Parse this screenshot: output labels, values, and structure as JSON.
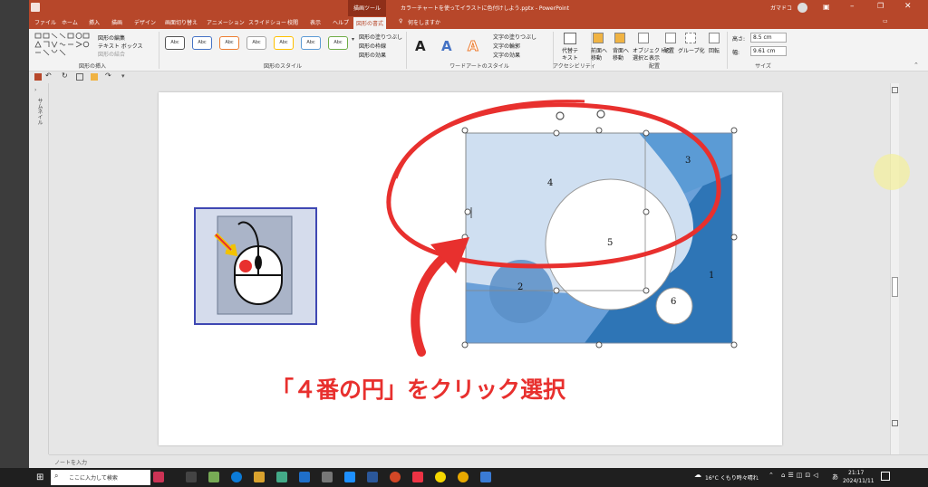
{
  "titlebar": {
    "context_label": "描画ツール",
    "doc_title": "カラーチャートを使ってイラストに色付けしよう.pptx - PowerPoint",
    "user": "ガマドコ"
  },
  "tabs": [
    "ファイル",
    "ホーム",
    "挿入",
    "描画",
    "デザイン",
    "画面切り替え",
    "アニメーション",
    "スライドショー",
    "校閲",
    "表示",
    "ヘルプ",
    "図形の書式"
  ],
  "tell_me": "何をしますか",
  "ribbon": {
    "insert_shapes": {
      "label": "図形の挿入",
      "edit_shape": "図形の編集",
      "text_box": "テキスト ボックス",
      "merge": "図形の結合"
    },
    "shape_styles": {
      "label": "図形のスタイル",
      "sample": "Abc",
      "fill": "図形の塗りつぶし",
      "outline": "図形の枠線",
      "effects": "図形の効果"
    },
    "wordart": {
      "label": "ワードアートのスタイル",
      "letter": "A",
      "text_fill": "文字の塗りつぶし",
      "text_outline": "文字の輪郭",
      "text_effects": "文字の効果"
    },
    "accessibility": {
      "label": "アクセシビリティ",
      "alt_text_1": "代替テ",
      "alt_text_2": "キスト"
    },
    "arrange": {
      "label": "配置",
      "forward_1": "前面へ",
      "forward_2": "移動",
      "backward_1": "背面へ",
      "backward_2": "移動",
      "selection_1": "オブジェクトの",
      "selection_2": "選択と表示",
      "align": "配置",
      "group": "グループ化",
      "rotate": "回転"
    },
    "size": {
      "label": "サイズ",
      "height_label": "高さ:",
      "height": "8.5 cm",
      "width_label": "幅:",
      "width": "9.61 cm"
    }
  },
  "thumb_label": "サムネイル",
  "slide": {
    "circle_labels": [
      "4",
      "3",
      "5",
      "1",
      "2",
      "6"
    ],
    "caption": "「４番の円」をクリック選択"
  },
  "notes": "ノートを入力",
  "taskbar": {
    "search": "ここに入力して検索",
    "weather": "16°C くもり時々晴れ",
    "time": "21:17",
    "date": "2024/11/11",
    "ime": "あ"
  },
  "colors": {
    "ppt_accent": "#b7472a",
    "circle_light": "#c9daf0",
    "circle_mid": "#5b9bd5",
    "circle_dark": "#2e75b6",
    "annotation_red": "#e8302e",
    "mouse_bg": "#aab4c8"
  }
}
